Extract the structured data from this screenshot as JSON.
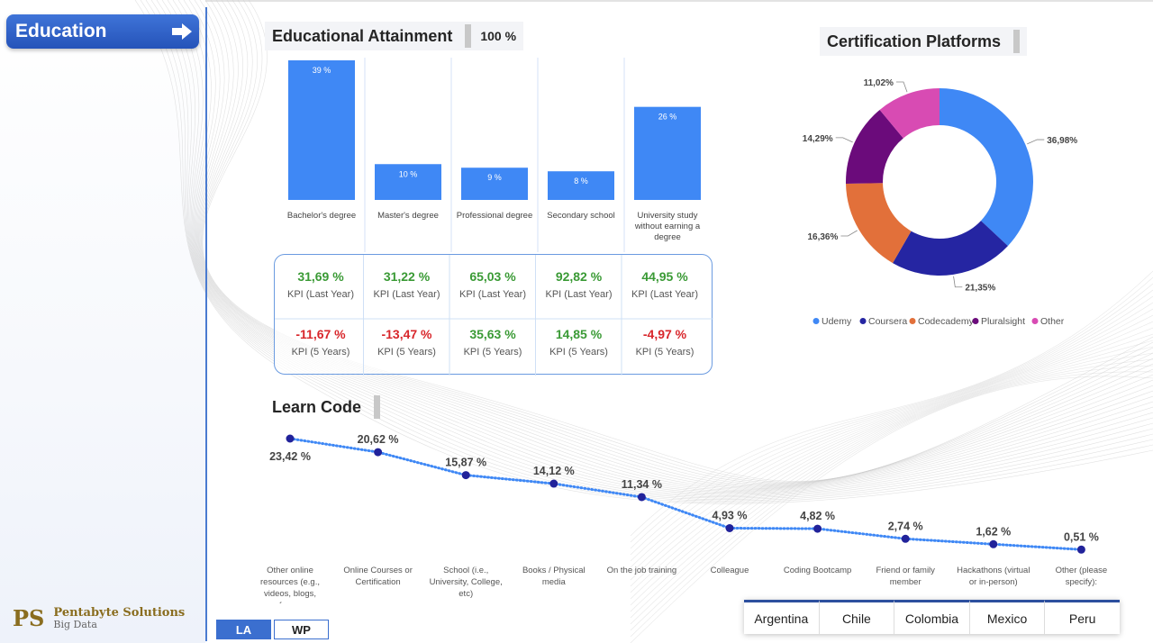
{
  "sidebar": {
    "nav_label": "Education",
    "logo_mark": "PS",
    "logo_name": "Pentabyte Solutions",
    "logo_sub": "Big Data",
    "toggles": [
      "LA",
      "WP"
    ]
  },
  "colors": {
    "bar": "#3f88f5",
    "line": "#3f88f5",
    "point": "#21229a",
    "accent": "#3b6fcf"
  },
  "countries": [
    "Argentina",
    "Chile",
    "Colombia",
    "Mexico",
    "Peru"
  ],
  "kpi": {
    "last_year": [
      {
        "value": "31,69 %",
        "label": "KPI (Last Year)"
      },
      {
        "value": "31,22 %",
        "label": "KPI (Last Year)"
      },
      {
        "value": "65,03 %",
        "label": "KPI (Last Year)"
      },
      {
        "value": "92,82 %",
        "label": "KPI (Last Year)"
      },
      {
        "value": "44,95 %",
        "label": "KPI (Last Year)"
      }
    ],
    "five_years": [
      {
        "value": "-11,67 %",
        "label": "KPI (5 Years)",
        "status": "negative"
      },
      {
        "value": "-13,47 %",
        "label": "KPI (5 Years)",
        "status": "negative"
      },
      {
        "value": "35,63 %",
        "label": "KPI (5 Years)",
        "status": "positive"
      },
      {
        "value": "14,85 %",
        "label": "KPI (5 Years)",
        "status": "positive"
      },
      {
        "value": "-4,97 %",
        "label": "KPI (5 Years)",
        "status": "negative"
      }
    ]
  },
  "chart_data": [
    {
      "type": "bar",
      "title": "Educational Attainment",
      "title_value": "100 %",
      "categories": [
        "Bachelor's degree",
        "Master's degree",
        "Professional degree",
        "Secondary school",
        "University study without earning a degree"
      ],
      "values": [
        39,
        10,
        9,
        8,
        26
      ],
      "data_labels": [
        "39 %",
        "10 %",
        "9 %",
        "8 %",
        "26 %"
      ],
      "ylim": [
        0,
        39
      ]
    },
    {
      "type": "pie",
      "title": "Certification Platforms",
      "labels": [
        "Udemy",
        "Coursera",
        "Codecademy",
        "Pluralsight",
        "Other"
      ],
      "values": [
        36.98,
        21.35,
        16.36,
        14.29,
        11.02
      ],
      "data_labels": [
        "36,98%",
        "21,35%",
        "16,36%",
        "14,29%",
        "11,02%"
      ],
      "colors": [
        "#3f88f5",
        "#2525a2",
        "#e2703a",
        "#6b0b7b",
        "#d84bb3"
      ],
      "legend": "bottom",
      "donut": true
    },
    {
      "type": "line",
      "title": "Learn Code",
      "categories": [
        "Other online resources (e.g., videos, blogs, foru...",
        "Online Courses or Certification",
        "School (i.e., University, College, etc)",
        "Books / Physical media",
        "On the job training",
        "Colleague",
        "Coding Bootcamp",
        "Friend or family member",
        "Hackathons (virtual or in-person)",
        "Other (please specify):"
      ],
      "values": [
        23.42,
        20.62,
        15.87,
        14.12,
        11.34,
        4.93,
        4.82,
        2.74,
        1.62,
        0.51
      ],
      "data_labels": [
        "23,42 %",
        "20,62 %",
        "15,87 %",
        "14,12 %",
        "11,34 %",
        "4,93 %",
        "4,82 %",
        "2,74 %",
        "1,62 %",
        "0,51 %"
      ],
      "ylim": [
        0,
        23.42
      ]
    }
  ]
}
